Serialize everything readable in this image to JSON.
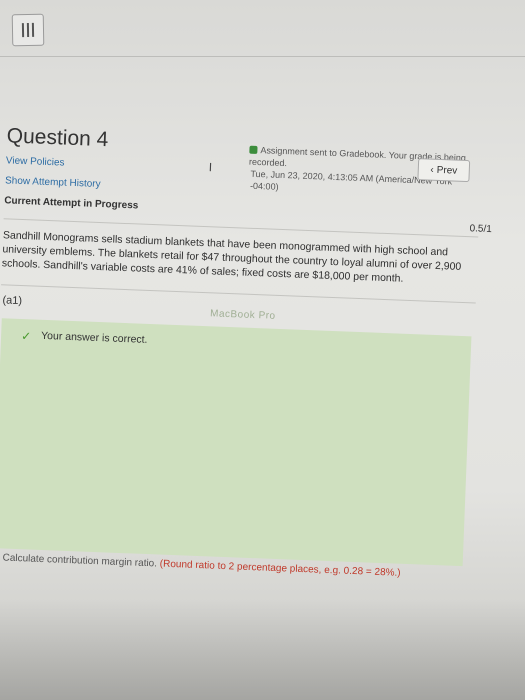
{
  "header": {
    "menu_icon": "menu-icon"
  },
  "notice": {
    "line1": "Assignment sent to Gradebook. Your grade is being recorded.",
    "line2": "Tue, Jun 23, 2020, 4:13:05 AM (America/New York -04:00)",
    "icon": "check-icon"
  },
  "nav": {
    "prev_label": "Prev",
    "prev_icon": "chevron-left-icon"
  },
  "question": {
    "title": "Question 4",
    "view_policies": "View Policies",
    "show_history": "Show Attempt History",
    "current_attempt": "Current Attempt in Progress",
    "score": "0.5/1"
  },
  "problem": {
    "text": "Sandhill Monograms sells stadium blankets that have been monogrammed with high school and university emblems. The blankets retail for $47 throughout the country to loyal alumni of over 2,900 schools. Sandhill's variable costs are 41% of sales; fixed costs are $18,000 per month."
  },
  "part": {
    "label": "(a1)",
    "feedback": "Your answer is correct.",
    "feedback_icon": "checkmark-icon"
  },
  "watermark": "MacBook Pro",
  "footer": {
    "text_start": "Calculate contribution margin ratio.",
    "text_red": "(Round ratio to 2 percentage places, e.g. 0.28 = 28%.)"
  },
  "colors": {
    "link": "#2e6da4",
    "correct_bg": "#cfe0bf",
    "check": "#4a9a2e"
  }
}
